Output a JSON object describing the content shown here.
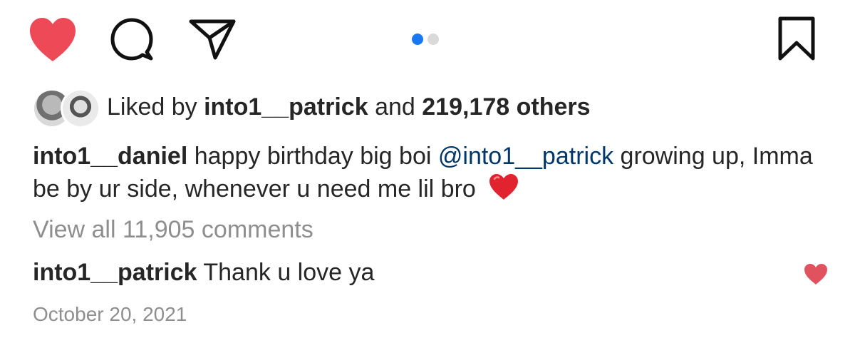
{
  "post_actions": {
    "like_icon": "heart-filled-icon",
    "comment_icon": "comment-bubble-icon",
    "share_icon": "paper-plane-icon",
    "save_icon": "bookmark-icon",
    "like_color": "#ed4956"
  },
  "carousel": {
    "total": 2,
    "active_index": 1,
    "active_color": "#1877f2",
    "inactive_color": "#d9d9d9"
  },
  "likes": {
    "prefix": "Liked by",
    "username": "into1__patrick",
    "joiner": "and",
    "others": "219,178 others"
  },
  "caption": {
    "username": "into1__daniel",
    "text_before": "happy birthday big boi",
    "mention": "@into1__patrick",
    "text_after": "growing up, Imma be by ur side, whenever u need me lil bro",
    "emoji": "red-heart-emoji"
  },
  "comments": {
    "view_all": "View all 11,905 comments",
    "items": [
      {
        "username": "into1__patrick",
        "text": "Thank u love ya",
        "like_icon": "heart-filled-icon"
      }
    ]
  },
  "date": "October 20, 2021"
}
